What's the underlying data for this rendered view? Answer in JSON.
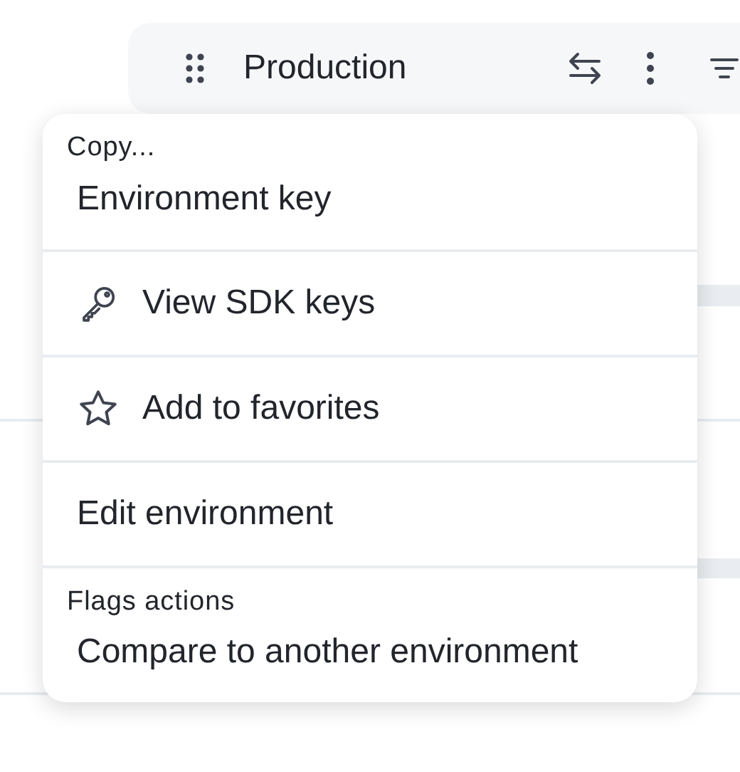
{
  "header": {
    "title": "Production"
  },
  "menu": {
    "sections": [
      {
        "heading": "Copy...",
        "items": [
          {
            "kind": "text",
            "label": "Environment key"
          }
        ]
      },
      {
        "items": [
          {
            "kind": "key",
            "label": "View SDK keys"
          }
        ]
      },
      {
        "items": [
          {
            "kind": "star",
            "label": "Add to favorites"
          }
        ]
      },
      {
        "items": [
          {
            "kind": "text",
            "label": "Edit environment"
          }
        ]
      },
      {
        "heading": "Flags actions",
        "items": [
          {
            "kind": "text",
            "label": "Compare to another environment"
          }
        ]
      }
    ]
  }
}
